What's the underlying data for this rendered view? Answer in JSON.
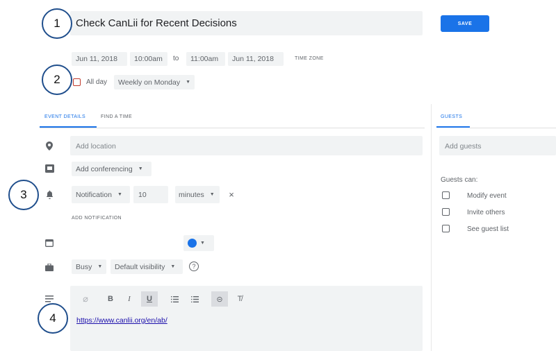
{
  "event": {
    "title": "Check CanLii for Recent Decisions",
    "save_label": "SAVE",
    "start_date": "Jun 11, 2018",
    "start_time": "10:00am",
    "to_label": "to",
    "end_time": "11:00am",
    "end_date": "Jun 11, 2018",
    "timezone_label": "TIME ZONE",
    "all_day_label": "All day",
    "recurrence": "Weekly on Monday"
  },
  "tabs": {
    "event_details": "EVENT DETAILS",
    "find_a_time": "FIND A TIME",
    "guests": "GUESTS"
  },
  "details": {
    "location_placeholder": "Add location",
    "conferencing_label": "Add conferencing",
    "notification_type": "Notification",
    "notification_value": "10",
    "notification_unit": "minutes",
    "add_notification_label": "ADD NOTIFICATION",
    "availability": "Busy",
    "visibility": "Default visibility",
    "calendar_color": "#1a73e8",
    "description_link": "https://www.canlii.org/en/ab/"
  },
  "guests": {
    "add_placeholder": "Add guests",
    "can_label": "Guests can:",
    "permissions": [
      "Modify event",
      "Invite others",
      "See guest list"
    ]
  },
  "toolbar": {
    "bold": "B",
    "italic": "I",
    "underline": "U",
    "link_glyph": "⊝",
    "clear_glyph": "T̸"
  },
  "annotations": {
    "one": "1",
    "two": "2",
    "three": "3",
    "four": "4"
  },
  "colors": {
    "accent": "#1a73e8",
    "annotation_border": "#1f4e8c"
  }
}
